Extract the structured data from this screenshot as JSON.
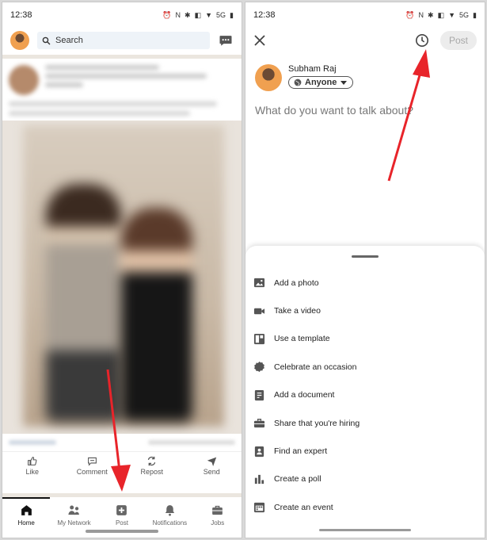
{
  "left": {
    "status": {
      "time": "12:38",
      "network": "5G"
    },
    "search": {
      "label": "Search"
    },
    "actions": [
      {
        "label": "Like",
        "icon": "thumbs-up-icon"
      },
      {
        "label": "Comment",
        "icon": "comment-icon"
      },
      {
        "label": "Repost",
        "icon": "repost-icon"
      },
      {
        "label": "Send",
        "icon": "send-icon"
      }
    ],
    "nav": [
      {
        "label": "Home",
        "icon": "home-icon",
        "active": true
      },
      {
        "label": "My Network",
        "icon": "network-icon"
      },
      {
        "label": "Post",
        "icon": "plus-square-icon"
      },
      {
        "label": "Notifications",
        "icon": "bell-icon"
      },
      {
        "label": "Jobs",
        "icon": "briefcase-icon"
      }
    ]
  },
  "right": {
    "status": {
      "time": "12:38",
      "network": "5G"
    },
    "post_button": "Post",
    "author": {
      "name": "Subham Raj",
      "visibility": "Anyone"
    },
    "prompt": "What do you want to talk about?",
    "sheet_items": [
      {
        "label": "Add a photo",
        "icon": "photo-icon"
      },
      {
        "label": "Take a video",
        "icon": "video-icon"
      },
      {
        "label": "Use a template",
        "icon": "template-icon"
      },
      {
        "label": "Celebrate an occasion",
        "icon": "badge-icon"
      },
      {
        "label": "Add a document",
        "icon": "document-icon"
      },
      {
        "label": "Share that you're hiring",
        "icon": "briefcase-icon"
      },
      {
        "label": "Find an expert",
        "icon": "expert-icon"
      },
      {
        "label": "Create a poll",
        "icon": "poll-icon"
      },
      {
        "label": "Create an event",
        "icon": "calendar-icon"
      }
    ]
  },
  "colors": {
    "accent_arrow": "#e8242a",
    "search_bg": "#eef3f8",
    "avatar_bg": "#f0a050"
  }
}
